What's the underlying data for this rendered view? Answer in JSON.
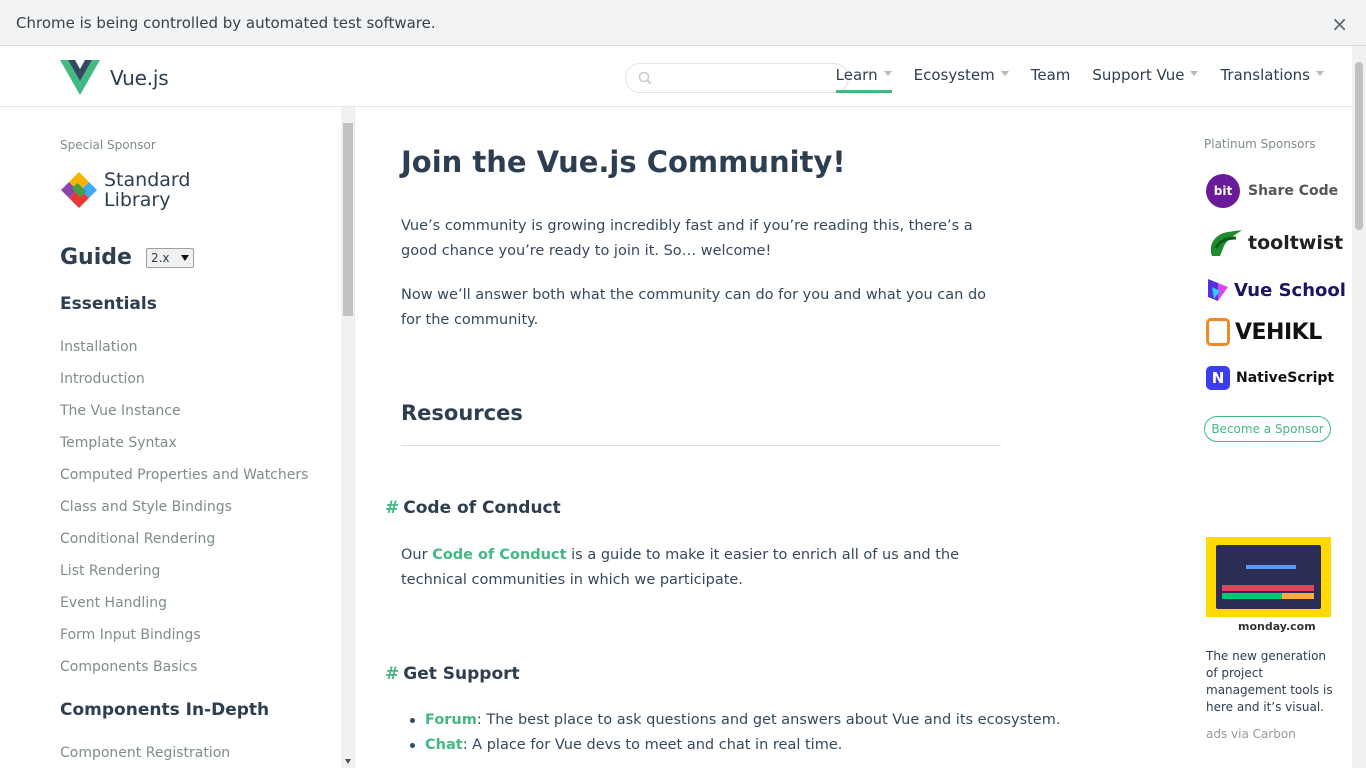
{
  "infobar": {
    "message": "Chrome is being controlled by automated test software.",
    "close": "×"
  },
  "header": {
    "logo_text": "Vue.js",
    "search_placeholder": "",
    "nav": [
      {
        "label": "Learn",
        "has_dropdown": true,
        "active": true
      },
      {
        "label": "Ecosystem",
        "has_dropdown": true
      },
      {
        "label": "Team",
        "has_dropdown": false
      },
      {
        "label": "Support Vue",
        "has_dropdown": true
      },
      {
        "label": "Translations",
        "has_dropdown": true
      }
    ]
  },
  "sidebar": {
    "special_sponsor_title": "Special Sponsor",
    "special_sponsor_line1": "Standard",
    "special_sponsor_line2": "Library",
    "guide_title": "Guide",
    "version": "2.x",
    "sections": [
      {
        "title": "Essentials"
      },
      {
        "title": "Components In-Depth"
      }
    ],
    "essentials_links": [
      "Installation",
      "Introduction",
      "The Vue Instance",
      "Template Syntax",
      "Computed Properties and Watchers",
      "Class and Style Bindings",
      "Conditional Rendering",
      "List Rendering",
      "Event Handling",
      "Form Input Bindings",
      "Components Basics"
    ],
    "components_links": [
      "Component Registration"
    ]
  },
  "content": {
    "title": "Join the Vue.js Community!",
    "intro1": "Vue’s community is growing incredibly fast and if you’re reading this, there’s a good chance you’re ready to join it. So… welcome!",
    "intro2": "Now we’ll answer both what the community can do for you and what you can do for the community.",
    "resources_title": "Resources",
    "coc_title": "Code of Conduct",
    "coc_prefix": "Our ",
    "coc_link": "Code of Conduct",
    "coc_suffix": " is a guide to make it easier to enrich all of us and the technical communities in which we participate.",
    "support_title": "Get Support",
    "support_items": [
      {
        "link": "Forum",
        "text": ": The best place to ask questions and get answers about Vue and its ecosystem."
      },
      {
        "link": "Chat",
        "text": ": A place for Vue devs to meet and chat in real time."
      }
    ],
    "hash": "#"
  },
  "right": {
    "platinum_title": "Platinum Sponsors",
    "sponsors": [
      {
        "name": "Share Code",
        "badge": "bit"
      },
      {
        "name": "tooltwist"
      },
      {
        "name": "Vue School"
      },
      {
        "name": "VEHIKL"
      },
      {
        "name": "NativeScript"
      }
    ],
    "become_sponsor": "Become a Sponsor",
    "ad_brand": "monday.com",
    "ad_text": "The new generation of project management tools is here and it’s visual.",
    "ad_via": "ads via Carbon"
  },
  "colors": {
    "accent": "#42b983",
    "text": "#2c3e50",
    "muted": "#7f8c8d"
  }
}
